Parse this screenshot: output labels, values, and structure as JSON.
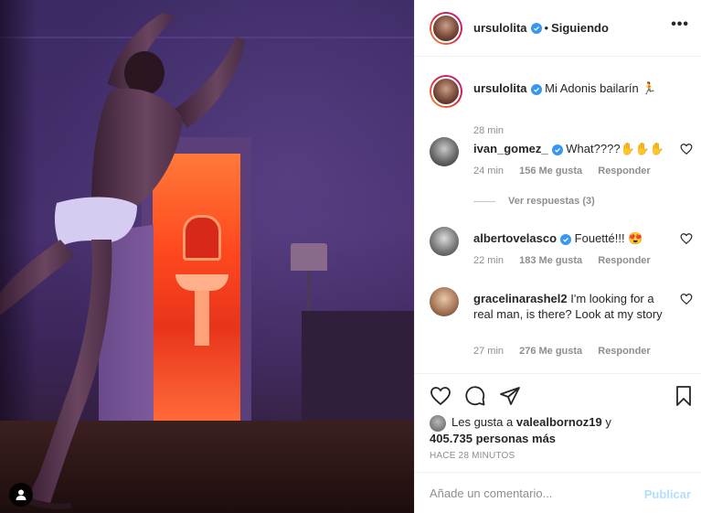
{
  "post": {
    "author": "ursulolita",
    "following_label": "Siguiendo",
    "more_label": "•••",
    "caption": "Mi Adonis bailarín 🏃",
    "caption_time": "28 min",
    "likes_text_prefix": "Les gusta a",
    "likes_user": "valealbornoz19",
    "likes_connector": "y",
    "likes_others": "405.735 personas más",
    "timestamp": "HACE 28 MINUTOS",
    "comment_placeholder": "Añade un comentario...",
    "publish_label": "Publicar"
  },
  "comments": [
    {
      "user": "ivan_gomez_",
      "verified": true,
      "text": "What????✋✋✋",
      "time": "24 min",
      "likes": "156 Me gusta",
      "reply": "Responder",
      "view_replies": "Ver respuestas (3)"
    },
    {
      "user": "albertovelasco",
      "verified": true,
      "text": "Fouetté!!! 😍",
      "time": "22 min",
      "likes": "183 Me gusta",
      "reply": "Responder"
    },
    {
      "user": "gracelinarashel2",
      "verified": false,
      "text": "I'm looking for a real man, is there? Look at my story",
      "time": "27 min",
      "likes": "276 Me gusta",
      "reply": "Responder"
    }
  ],
  "icons": {
    "like": "heart-icon",
    "comment": "comment-icon",
    "share": "paper-plane-icon",
    "save": "bookmark-icon",
    "tag": "user-tag-icon",
    "verified": "verified-badge-icon"
  },
  "colors": {
    "verified": "#3897f0",
    "publish_disabled": "#b2dffc",
    "meta_gray": "#8e8e8e"
  }
}
